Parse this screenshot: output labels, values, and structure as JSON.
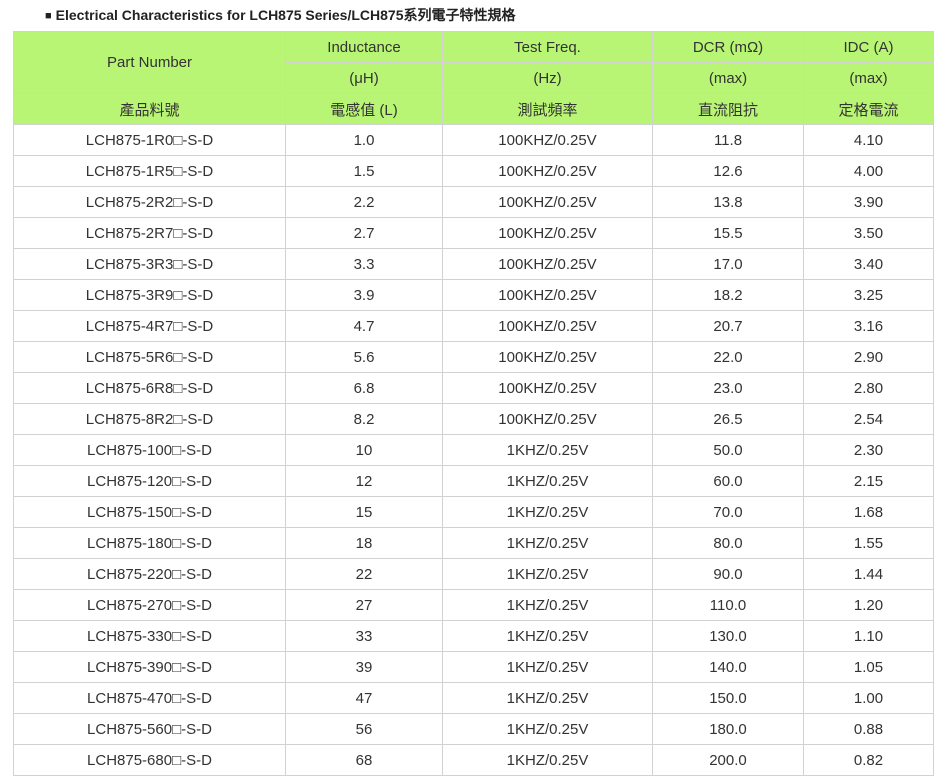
{
  "heading": {
    "bullet": "■",
    "title": "Electrical Characteristics for LCH875 Series/LCH875系列電子特性規格"
  },
  "table": {
    "header": {
      "part_number": "Part Number",
      "part_number_zh": "產品料號",
      "inductance": "Inductance",
      "inductance_unit": "(μH)",
      "inductance_zh": "電感值 (L)",
      "test_freq": "Test Freq.",
      "test_freq_unit": "(Hz)",
      "test_freq_zh": "測試頻率",
      "dcr": "DCR (mΩ)",
      "dcr_unit": "(max)",
      "dcr_zh": "直流阻抗",
      "idc": "IDC (A)",
      "idc_unit": "(max)",
      "idc_zh": "定格電流"
    },
    "rows": [
      {
        "part": "LCH875-1R0□-S-D",
        "inductance": "1.0",
        "freq": "100KHZ/0.25V",
        "dcr": "11.8",
        "idc": "4.10"
      },
      {
        "part": "LCH875-1R5□-S-D",
        "inductance": "1.5",
        "freq": "100KHZ/0.25V",
        "dcr": "12.6",
        "idc": "4.00"
      },
      {
        "part": "LCH875-2R2□-S-D",
        "inductance": "2.2",
        "freq": "100KHZ/0.25V",
        "dcr": "13.8",
        "idc": "3.90"
      },
      {
        "part": "LCH875-2R7□-S-D",
        "inductance": "2.7",
        "freq": "100KHZ/0.25V",
        "dcr": "15.5",
        "idc": "3.50"
      },
      {
        "part": "LCH875-3R3□-S-D",
        "inductance": "3.3",
        "freq": "100KHZ/0.25V",
        "dcr": "17.0",
        "idc": "3.40"
      },
      {
        "part": "LCH875-3R9□-S-D",
        "inductance": "3.9",
        "freq": "100KHZ/0.25V",
        "dcr": "18.2",
        "idc": "3.25"
      },
      {
        "part": "LCH875-4R7□-S-D",
        "inductance": "4.7",
        "freq": "100KHZ/0.25V",
        "dcr": "20.7",
        "idc": "3.16"
      },
      {
        "part": "LCH875-5R6□-S-D",
        "inductance": "5.6",
        "freq": "100KHZ/0.25V",
        "dcr": "22.0",
        "idc": "2.90"
      },
      {
        "part": "LCH875-6R8□-S-D",
        "inductance": "6.8",
        "freq": "100KHZ/0.25V",
        "dcr": "23.0",
        "idc": "2.80"
      },
      {
        "part": "LCH875-8R2□-S-D",
        "inductance": "8.2",
        "freq": "100KHZ/0.25V",
        "dcr": "26.5",
        "idc": "2.54"
      },
      {
        "part": "LCH875-100□-S-D",
        "inductance": "10",
        "freq": "1KHZ/0.25V",
        "dcr": "50.0",
        "idc": "2.30"
      },
      {
        "part": "LCH875-120□-S-D",
        "inductance": "12",
        "freq": "1KHZ/0.25V",
        "dcr": "60.0",
        "idc": "2.15"
      },
      {
        "part": "LCH875-150□-S-D",
        "inductance": "15",
        "freq": "1KHZ/0.25V",
        "dcr": "70.0",
        "idc": "1.68"
      },
      {
        "part": "LCH875-180□-S-D",
        "inductance": "18",
        "freq": "1KHZ/0.25V",
        "dcr": "80.0",
        "idc": "1.55"
      },
      {
        "part": "LCH875-220□-S-D",
        "inductance": "22",
        "freq": "1KHZ/0.25V",
        "dcr": "90.0",
        "idc": "1.44"
      },
      {
        "part": "LCH875-270□-S-D",
        "inductance": "27",
        "freq": "1KHZ/0.25V",
        "dcr": "110.0",
        "idc": "1.20"
      },
      {
        "part": "LCH875-330□-S-D",
        "inductance": "33",
        "freq": "1KHZ/0.25V",
        "dcr": "130.0",
        "idc": "1.10"
      },
      {
        "part": "LCH875-390□-S-D",
        "inductance": "39",
        "freq": "1KHZ/0.25V",
        "dcr": "140.0",
        "idc": "1.05"
      },
      {
        "part": "LCH875-470□-S-D",
        "inductance": "47",
        "freq": "1KHZ/0.25V",
        "dcr": "150.0",
        "idc": "1.00"
      },
      {
        "part": "LCH875-560□-S-D",
        "inductance": "56",
        "freq": "1KHZ/0.25V",
        "dcr": "180.0",
        "idc": "0.88"
      },
      {
        "part": "LCH875-680□-S-D",
        "inductance": "68",
        "freq": "1KHZ/0.25V",
        "dcr": "200.0",
        "idc": "0.82"
      }
    ]
  },
  "colors": {
    "header_bg": "#b9f574",
    "border": "#d2d2d2",
    "text": "#333333"
  }
}
